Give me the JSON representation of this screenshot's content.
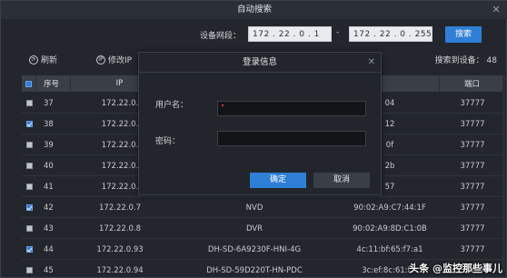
{
  "window": {
    "title": "自动搜索",
    "close": "✕"
  },
  "segment": {
    "label": "设备网段：",
    "start_ip": "172 . 22 . 0 . 1",
    "dash": "-",
    "end_ip": "172 . 22 . 0 . 255",
    "search_label": "搜索"
  },
  "toolbar": {
    "refresh_label": "刷新",
    "modify_ip_label": "修改IP",
    "found_text": "搜索到设备：  48"
  },
  "table": {
    "headers": {
      "no": "序号",
      "ip": "IP",
      "type": "",
      "mac": "",
      "port": "端口"
    },
    "rows": [
      {
        "checked": false,
        "no": "37",
        "ip": "172.22.0.",
        "type": "",
        "mac": "04",
        "port": "37777"
      },
      {
        "checked": true,
        "no": "38",
        "ip": "172.22.0.",
        "type": "",
        "mac": "12",
        "port": "37777"
      },
      {
        "checked": false,
        "no": "39",
        "ip": "172.22.0.",
        "type": "",
        "mac": "0f",
        "port": "37777"
      },
      {
        "checked": false,
        "no": "40",
        "ip": "172.22.0.",
        "type": "",
        "mac": "2b",
        "port": "37777"
      },
      {
        "checked": false,
        "no": "41",
        "ip": "172.22.0.",
        "type": "",
        "mac": "57",
        "port": "37777"
      },
      {
        "checked": true,
        "no": "42",
        "ip": "172.22.0.7",
        "type": "NVD",
        "mac": "90:02:A9:C7:44:1F",
        "port": "37777"
      },
      {
        "checked": false,
        "no": "43",
        "ip": "172.22.0.8",
        "type": "DVR",
        "mac": "90:02:A9:8D:C1:0B",
        "port": "37777"
      },
      {
        "checked": true,
        "no": "44",
        "ip": "172.22.0.93",
        "type": "DH-SD-6A9230F-HNI-4G",
        "mac": "4c:11:bf:65:f7:a1",
        "port": "37777"
      },
      {
        "checked": false,
        "no": "45",
        "ip": "172.22.0.94",
        "type": "DH-SD-59D220T-HN-PDC",
        "mac": "3c:ef:8c:61:f7:",
        "port": "37777"
      }
    ]
  },
  "dialog": {
    "title": "登录信息",
    "close": "✕",
    "username_label": "用户名：",
    "password_label": "密码：",
    "ok_label": "确定",
    "cancel_label": "取消"
  },
  "watermark": "头条 @监控那些事儿",
  "colors": {
    "accent": "#2f7fd7",
    "background": "#23272d",
    "header": "#3a3f47"
  }
}
